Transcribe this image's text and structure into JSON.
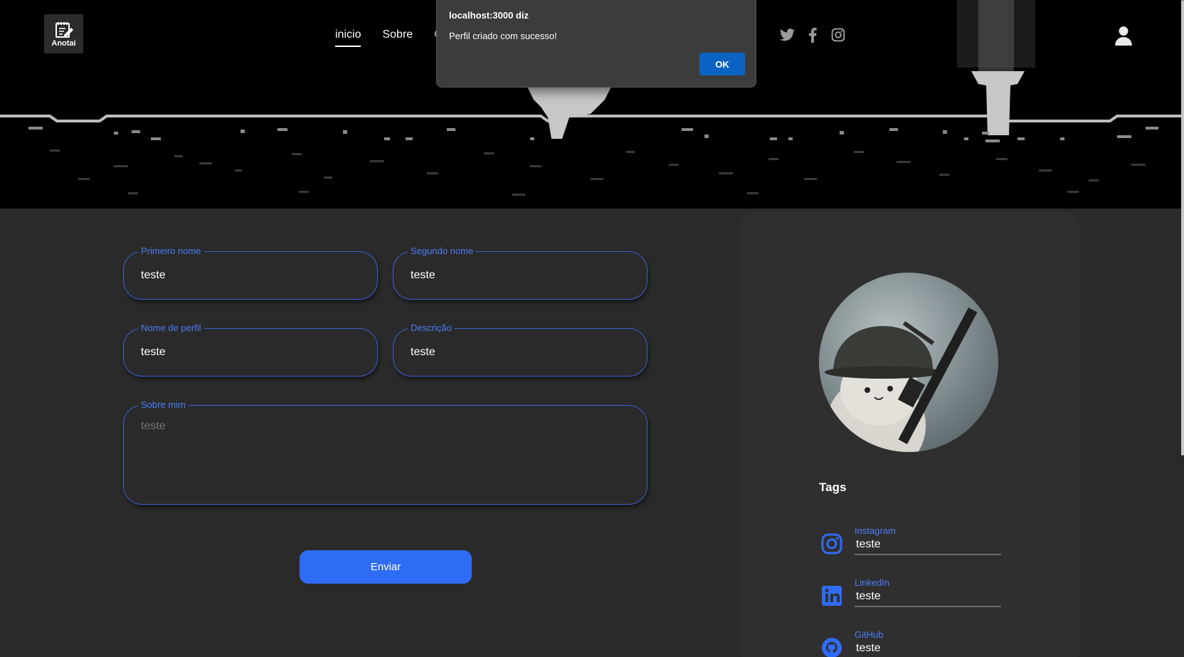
{
  "header": {
    "logo_text": "Anotai",
    "nav": [
      {
        "label": "inicio",
        "active": true
      },
      {
        "label": "Sobre",
        "active": false
      },
      {
        "label": "C",
        "active": false
      }
    ],
    "socials": [
      "twitter-icon",
      "facebook-icon",
      "instagram-icon"
    ],
    "user_icon": "user-icon"
  },
  "alert": {
    "title": "localhost:3000 diz",
    "message": "Perfil criado com sucesso!",
    "ok_label": "OK"
  },
  "form": {
    "first_name": {
      "label": "Primeiro nome",
      "value": "teste"
    },
    "second_name": {
      "label": "Segundo nome",
      "value": "teste"
    },
    "profile_name": {
      "label": "Nome de perfil",
      "value": "teste"
    },
    "description": {
      "label": "Descrição",
      "value": "teste"
    },
    "about": {
      "label": "Sobre mim",
      "placeholder": "teste"
    },
    "submit_label": "Enviar"
  },
  "profile": {
    "tags_title": "Tags",
    "tags": [
      {
        "label": "Instagram",
        "value": "teste",
        "icon": "instagram-icon"
      },
      {
        "label": "LinkedIn",
        "value": "teste",
        "icon": "linkedin-icon"
      },
      {
        "label": "GitHub",
        "value": "teste",
        "icon": "github-icon"
      }
    ]
  },
  "colors": {
    "accent": "#2f6cf6",
    "field_border": "#3b63d6",
    "label": "#4d7cf6",
    "background": "#2a2a2a",
    "card": "#2f2f2f"
  }
}
